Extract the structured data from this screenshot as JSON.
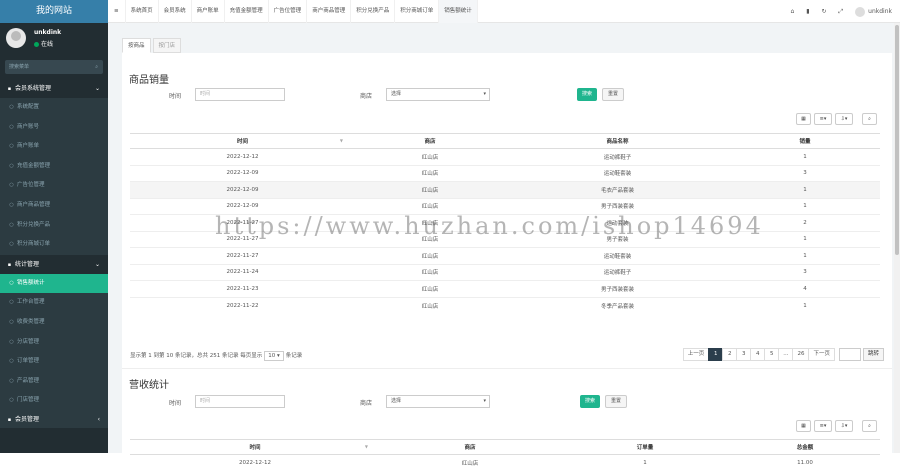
{
  "sidebar": {
    "logo": "我的网站",
    "user_name": "unkdink",
    "user_status": "在线",
    "search_placeholder": "搜索菜单",
    "group1": "会员系统管理",
    "items1": [
      "系统配置",
      "商户账号",
      "商户账单",
      "充值金额管理",
      "广告位管理",
      "商户商品管理",
      "积分兑换产品",
      "积分商城订单"
    ],
    "group2": "统计管理",
    "items2": [
      "销售额统计",
      "工作台管理",
      "收费类管理",
      "分店管理",
      "订单管理",
      "产品管理",
      "门店管理"
    ],
    "group3": "会员管理"
  },
  "topbar": {
    "tabs": [
      "系统首页",
      "会员系统",
      "商户账单",
      "充值金额管理",
      "广告位管理",
      "商户商品管理",
      "积分兑换产品",
      "积分商城订单",
      "销售额统计"
    ],
    "user": "unkdink"
  },
  "content_tabs": [
    "按商品",
    "按门店"
  ],
  "sales": {
    "title": "商品销量",
    "time_label": "时间",
    "time_placeholder": "时间",
    "store_label": "商店",
    "store_placeholder": "选择",
    "btn_search": "搜索",
    "btn_reset": "重置",
    "columns": [
      "时间",
      "商店",
      "商品名称",
      "销量"
    ],
    "rows": [
      [
        "2022-12-12",
        "红山店",
        "运动裤鞋子",
        "1"
      ],
      [
        "2022-12-09",
        "红山店",
        "运动鞋套装",
        "3"
      ],
      [
        "2022-12-09",
        "红山店",
        "毛衣产品套装",
        "1"
      ],
      [
        "2022-12-09",
        "红山店",
        "男子西装套装",
        "1"
      ],
      [
        "2022-11-27",
        "红山店",
        "运动套装",
        "2"
      ],
      [
        "2022-11-27",
        "红山店",
        "男子套装",
        "1"
      ],
      [
        "2022-11-27",
        "红山店",
        "运动鞋套装",
        "1"
      ],
      [
        "2022-11-24",
        "红山店",
        "运动裤鞋子",
        "3"
      ],
      [
        "2022-11-23",
        "红山店",
        "男子西装套装",
        "4"
      ],
      [
        "2022-11-22",
        "红山店",
        "冬季产品套装",
        "1"
      ]
    ],
    "info_prefix": "显示第 1 到第 10 条记录，总共 251 条记录 每页显示",
    "page_size": "10",
    "info_suffix": "条记录",
    "pages": [
      "上一页",
      "1",
      "2",
      "3",
      "4",
      "5",
      "...",
      "26",
      "下一页"
    ],
    "jump": "跳转"
  },
  "revenue": {
    "title": "营收统计",
    "time_label": "时间",
    "time_placeholder": "时间",
    "store_label": "商店",
    "store_placeholder": "选择",
    "btn_search": "搜索",
    "btn_reset": "重置",
    "columns": [
      "时间",
      "商店",
      "订单量",
      "总金额"
    ],
    "rows": [
      [
        "2022-12-12",
        "红山店",
        "1",
        "11.00"
      ]
    ]
  },
  "watermark": "https://www.huzhan.com/ishop14694"
}
